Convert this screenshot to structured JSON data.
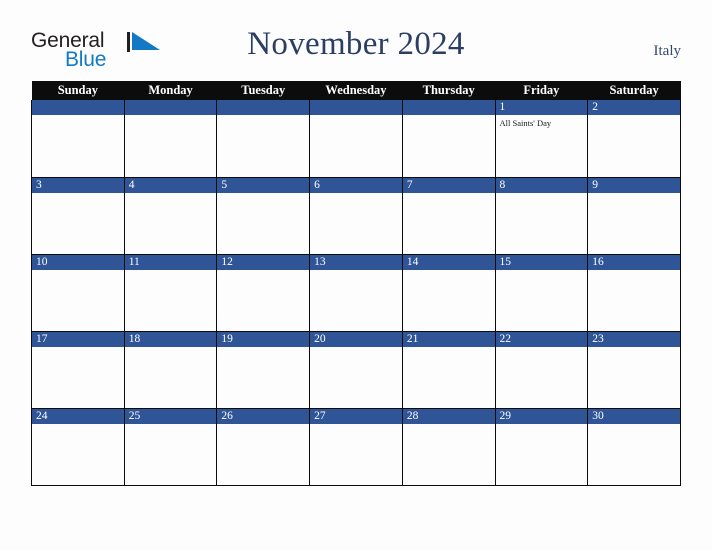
{
  "brand": {
    "name_part1": "General",
    "name_part2": "Blue",
    "mark": "triangle-icon",
    "color_dark": "#231f20",
    "color_blue": "#1379c4"
  },
  "header": {
    "title": "November 2024",
    "country": "Italy",
    "title_color": "#2c3e63"
  },
  "calendar": {
    "month": "November",
    "year": "2024",
    "weekday_headers": [
      "Sunday",
      "Monday",
      "Tuesday",
      "Wednesday",
      "Thursday",
      "Friday",
      "Saturday"
    ],
    "header_bg": "#0c0c0c",
    "date_bar_bg": "#2f5597",
    "cell_bg": "#fdfdfd",
    "weeks": [
      [
        {
          "date": "",
          "events": []
        },
        {
          "date": "",
          "events": []
        },
        {
          "date": "",
          "events": []
        },
        {
          "date": "",
          "events": []
        },
        {
          "date": "",
          "events": []
        },
        {
          "date": "1",
          "events": [
            "All Saints' Day"
          ]
        },
        {
          "date": "2",
          "events": []
        }
      ],
      [
        {
          "date": "3",
          "events": []
        },
        {
          "date": "4",
          "events": []
        },
        {
          "date": "5",
          "events": []
        },
        {
          "date": "6",
          "events": []
        },
        {
          "date": "7",
          "events": []
        },
        {
          "date": "8",
          "events": []
        },
        {
          "date": "9",
          "events": []
        }
      ],
      [
        {
          "date": "10",
          "events": []
        },
        {
          "date": "11",
          "events": []
        },
        {
          "date": "12",
          "events": []
        },
        {
          "date": "13",
          "events": []
        },
        {
          "date": "14",
          "events": []
        },
        {
          "date": "15",
          "events": []
        },
        {
          "date": "16",
          "events": []
        }
      ],
      [
        {
          "date": "17",
          "events": []
        },
        {
          "date": "18",
          "events": []
        },
        {
          "date": "19",
          "events": []
        },
        {
          "date": "20",
          "events": []
        },
        {
          "date": "21",
          "events": []
        },
        {
          "date": "22",
          "events": []
        },
        {
          "date": "23",
          "events": []
        }
      ],
      [
        {
          "date": "24",
          "events": []
        },
        {
          "date": "25",
          "events": []
        },
        {
          "date": "26",
          "events": []
        },
        {
          "date": "27",
          "events": []
        },
        {
          "date": "28",
          "events": []
        },
        {
          "date": "29",
          "events": []
        },
        {
          "date": "30",
          "events": []
        }
      ]
    ]
  }
}
